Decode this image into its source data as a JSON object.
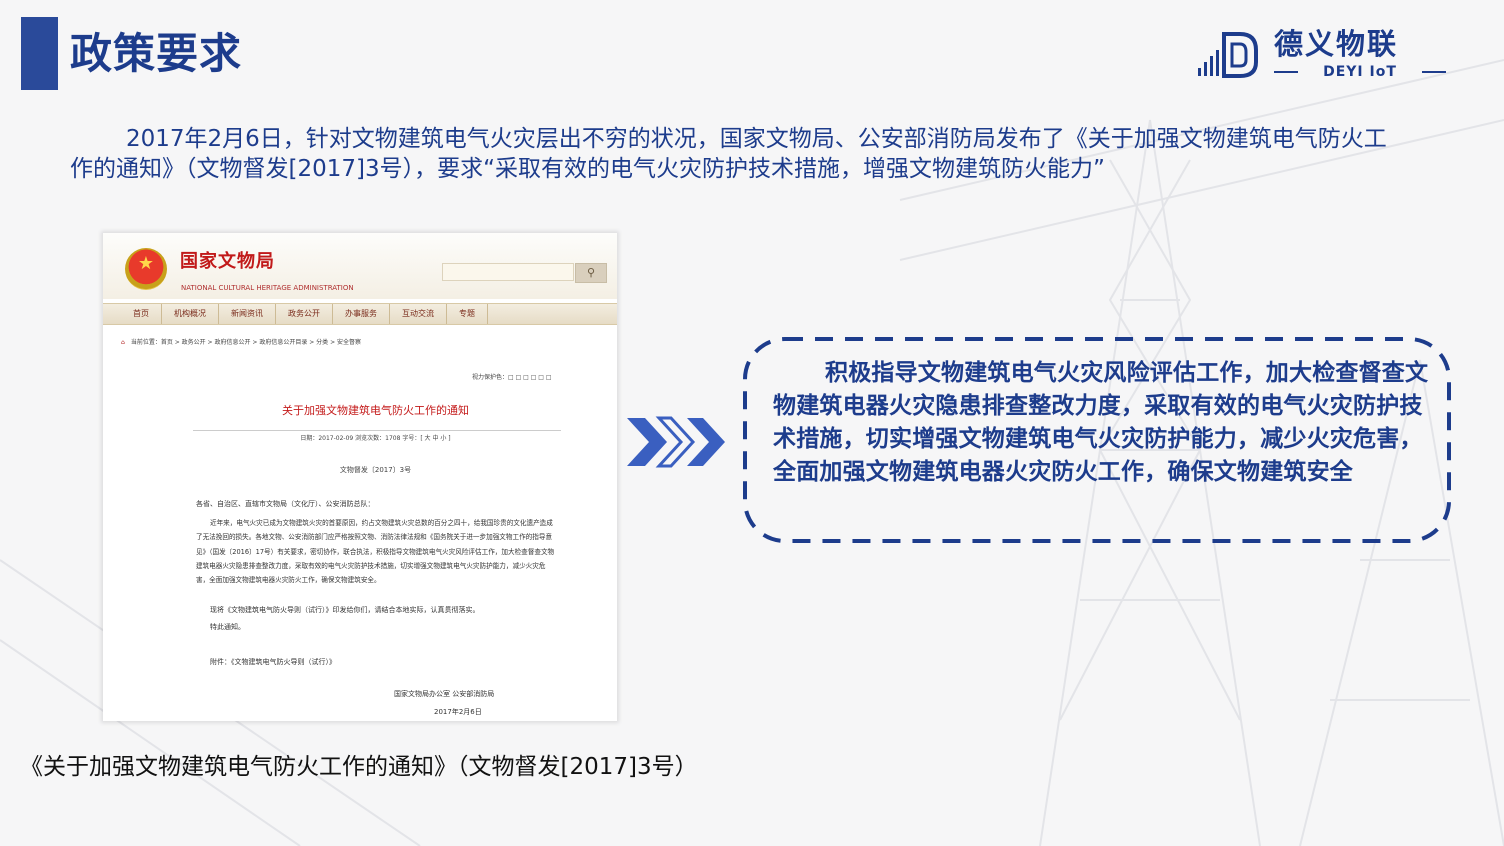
{
  "header": {
    "title": "政策要求",
    "logo_cn": "德义物联",
    "logo_en": "DEYI IoT"
  },
  "intro": {
    "text": "2017年2月6日，针对文物建筑电气火灾层出不穷的状况，国家文物局、公安部消防局发布了《关于加强文物建筑电气防火工作的通知》（文物督发[2017]3号），要求“采取有效的电气火灾防护技术措施，增强文物建筑防火能力”"
  },
  "document": {
    "site_name": "国家文物局",
    "site_name_en": "NATIONAL CULTURAL HERITAGE ADMINISTRATION",
    "search_icon": "search-icon",
    "nav": [
      "首页",
      "机构概况",
      "新闻资讯",
      "政务公开",
      "办事服务",
      "互动交流",
      "专题"
    ],
    "breadcrumb": "当前位置：首页 > 政务公开 > 政府信息公开 > 政府信息公开目录 > 分类 > 安全督察",
    "font_size_label": "视力保护色：□ □ □ □ □ □",
    "title": "关于加强文物建筑电气防火工作的通知",
    "meta": "日期：2017-02-09    浏览次数：1708    字号：[ 大 中 小 ]",
    "doc_number": "文物督发〔2017〕3号",
    "addressee": "各省、自治区、直辖市文物局（文化厅）、公安消防总队：",
    "body": "近年来，电气火灾已成为文物建筑火灾的首要原因，约占文物建筑火灾总数的百分之四十，给我国珍贵的文化遗产造成了无法挽回的损失。各地文物、公安消防部门应严格按照文物、消防法律法规和《国务院关于进一步加强文物工作的指导意见》（国发〔2016〕17号）有关要求，密切协作，联合执法，积极指导文物建筑电气火灾风险评估工作，加大检查督查文物建筑电器火灾隐患排查整改力度，采取有效的电气火灾防护技术措施，切实增强文物建筑电气火灾防护能力，减少火灾危害，全面加强文物建筑电器火灾防火工作，确保文物建筑安全。",
    "line_guide": "现将《文物建筑电气防火导则（试行）》印发给你们，请结合本地实际，认真贯彻落实。",
    "line_notice": "特此通知。",
    "attachment": "附件：《文物建筑电气防火导则（试行）》",
    "signature": "国家文物局办公室    公安部消防局",
    "date": "2017年2月6日"
  },
  "caption": "《关于加强文物建筑电气防火工作的通知》（文物督发[2017]3号）",
  "callout": {
    "text": "积极指导文物建筑电气火灾风险评估工作，加大检查督查文物建筑电器火灾隐患排查整改力度，采取有效的电气火灾防护技术措施，切实增强文物建筑电气火灾防护能力，减少火灾危害，全面加强文物建筑电器火灾防火工作，确保文物建筑安全"
  },
  "colors": {
    "primary": "#1d3c8c",
    "title_bar": "#2a4a9a",
    "chevron": "#3a5fc0",
    "doc_red": "#c41a1a"
  }
}
